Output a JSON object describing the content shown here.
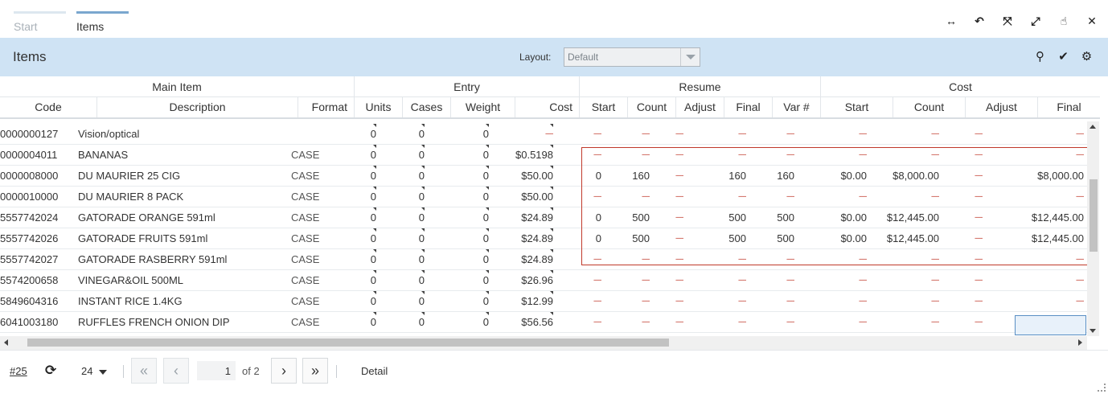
{
  "tabs": [
    {
      "label": "Start"
    },
    {
      "label": "Items"
    }
  ],
  "window_controls": [
    "swap-horizontal-icon",
    "undo-icon",
    "compress-icon",
    "expand-icon",
    "pointer-hand-icon",
    "close-icon"
  ],
  "panel": {
    "title": "Items",
    "layout_label": "Layout:",
    "layout_value": "Default",
    "icons": [
      "search-icon",
      "check-icon",
      "gears-icon"
    ]
  },
  "grid": {
    "groups": [
      "Main Item",
      "Entry",
      "Resume",
      "Cost"
    ],
    "columns": [
      "Code",
      "Description",
      "Format",
      "Units",
      "Cases",
      "Weight",
      "Cost",
      "Start",
      "Count",
      "Adjust",
      "Final",
      "Var #",
      "Start",
      "Count",
      "Adjust",
      "Final"
    ],
    "dash": "-----",
    "rows": [
      {
        "code": "0000000127",
        "desc": "Vision/optical",
        "fmt": "",
        "units": "0",
        "cases": "0",
        "weight": "0",
        "cost": "-----",
        "r_start": "-----",
        "r_count": "-----",
        "r_adjust": "-----",
        "r_final": "-----",
        "r_var": "-----",
        "c_start": "-----",
        "c_count": "-----",
        "c_adjust": "-----",
        "c_final": "-----"
      },
      {
        "code": "0000004011",
        "desc": "BANANAS",
        "fmt": "CASE",
        "units": "0",
        "cases": "0",
        "weight": "0",
        "cost": "$0.5198",
        "r_start": "-----",
        "r_count": "-----",
        "r_adjust": "-----",
        "r_final": "-----",
        "r_var": "-----",
        "c_start": "-----",
        "c_count": "-----",
        "c_adjust": "-----",
        "c_final": "-----"
      },
      {
        "code": "0000008000",
        "desc": "DU MAURIER 25 CIG",
        "fmt": "CASE",
        "units": "0",
        "cases": "0",
        "weight": "0",
        "cost": "$50.00",
        "r_start": "0",
        "r_count": "160",
        "r_adjust": "-----",
        "r_final": "160",
        "r_var": "160",
        "c_start": "$0.00",
        "c_count": "$8,000.00",
        "c_adjust": "-----",
        "c_final": "$8,000.00"
      },
      {
        "code": "0000010000",
        "desc": "DU MAURIER 8 PACK",
        "fmt": "CASE",
        "units": "0",
        "cases": "0",
        "weight": "0",
        "cost": "$50.00",
        "r_start": "-----",
        "r_count": "-----",
        "r_adjust": "-----",
        "r_final": "-----",
        "r_var": "-----",
        "c_start": "-----",
        "c_count": "-----",
        "c_adjust": "-----",
        "c_final": "-----"
      },
      {
        "code": "5557742024",
        "desc": "GATORADE ORANGE 591ml",
        "fmt": "CASE",
        "units": "0",
        "cases": "0",
        "weight": "0",
        "cost": "$24.89",
        "r_start": "0",
        "r_count": "500",
        "r_adjust": "-----",
        "r_final": "500",
        "r_var": "500",
        "c_start": "$0.00",
        "c_count": "$12,445.00",
        "c_adjust": "-----",
        "c_final": "$12,445.00"
      },
      {
        "code": "5557742026",
        "desc": "GATORADE FRUITS 591ml",
        "fmt": "CASE",
        "units": "0",
        "cases": "0",
        "weight": "0",
        "cost": "$24.89",
        "r_start": "0",
        "r_count": "500",
        "r_adjust": "-----",
        "r_final": "500",
        "r_var": "500",
        "c_start": "$0.00",
        "c_count": "$12,445.00",
        "c_adjust": "-----",
        "c_final": "$12,445.00"
      },
      {
        "code": "5557742027",
        "desc": "GATORADE RASBERRY 591ml",
        "fmt": "CASE",
        "units": "0",
        "cases": "0",
        "weight": "0",
        "cost": "$24.89",
        "r_start": "-----",
        "r_count": "-----",
        "r_adjust": "-----",
        "r_final": "-----",
        "r_var": "-----",
        "c_start": "-----",
        "c_count": "-----",
        "c_adjust": "-----",
        "c_final": "-----"
      },
      {
        "code": "5574200658",
        "desc": "VINEGAR&OIL 500ML",
        "fmt": "CASE",
        "units": "0",
        "cases": "0",
        "weight": "0",
        "cost": "$26.96",
        "r_start": "-----",
        "r_count": "-----",
        "r_adjust": "-----",
        "r_final": "-----",
        "r_var": "-----",
        "c_start": "-----",
        "c_count": "-----",
        "c_adjust": "-----",
        "c_final": "-----"
      },
      {
        "code": "5849604316",
        "desc": "INSTANT RICE 1.4KG",
        "fmt": "CASE",
        "units": "0",
        "cases": "0",
        "weight": "0",
        "cost": "$12.99",
        "r_start": "-----",
        "r_count": "-----",
        "r_adjust": "-----",
        "r_final": "-----",
        "r_var": "-----",
        "c_start": "-----",
        "c_count": "-----",
        "c_adjust": "-----",
        "c_final": "-----"
      },
      {
        "code": "6041003180",
        "desc": "RUFFLES FRENCH ONION DIP",
        "fmt": "CASE",
        "units": "0",
        "cases": "0",
        "weight": "0",
        "cost": "$56.56",
        "r_start": "-----",
        "r_count": "-----",
        "r_adjust": "-----",
        "r_final": "-----",
        "r_var": "-----",
        "c_start": "-----",
        "c_count": "-----",
        "c_adjust": "-----",
        "c_final": "-----"
      }
    ]
  },
  "footer": {
    "record_link": "#25",
    "page_size": "24",
    "page_value": "1",
    "of_text": "of 2",
    "detail_label": "Detail"
  }
}
